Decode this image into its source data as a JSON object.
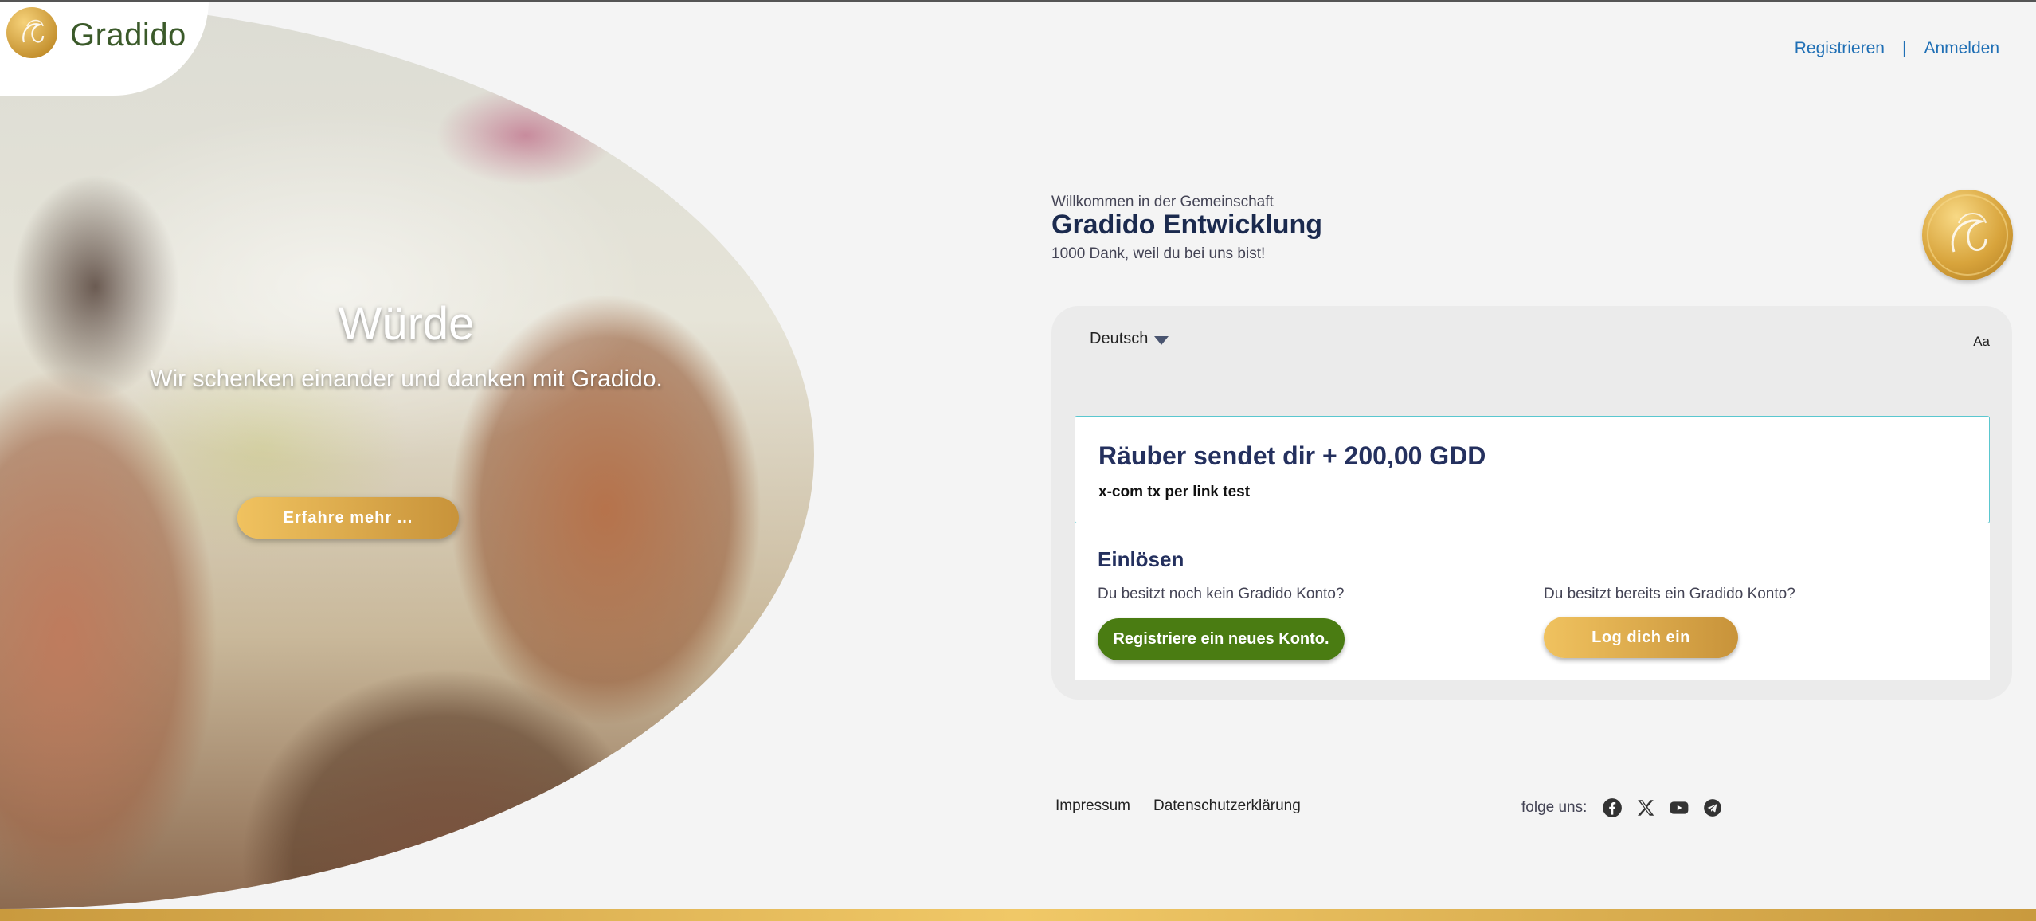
{
  "header": {
    "logo_text": "Gradido",
    "nav": {
      "register": "Registrieren",
      "separator": "|",
      "login": "Anmelden"
    }
  },
  "hero": {
    "title": "Würde",
    "subtitle": "Wir schenken einander und danken mit Gradido.",
    "button": "Erfahre mehr ..."
  },
  "welcome": {
    "intro": "Willkommen in der Gemeinschaft",
    "community": "Gradido Entwicklung",
    "thanks": "1000 Dank, weil du bei uns bist!"
  },
  "card": {
    "language": "Deutsch",
    "font_toggle": "Aa",
    "transaction": {
      "title": "Räuber sendet dir + 200,00 GDD",
      "memo": "x-com tx per link test"
    },
    "redeem": {
      "title": "Einlösen",
      "no_account_question": "Du besitzt noch kein Gradido Konto?",
      "has_account_question": "Du besitzt bereits ein Gradido Konto?",
      "register_button": "Registriere ein neues Konto.",
      "login_button": "Log dich ein"
    }
  },
  "footer": {
    "imprint": "Impressum",
    "privacy": "Datenschutzerklärung",
    "follow_label": "folge uns:",
    "social_icons": [
      "facebook-icon",
      "x-icon",
      "youtube-icon",
      "telegram-icon"
    ]
  },
  "colors": {
    "gold": "#d4a64a",
    "green": "#4a7c12",
    "link_blue": "#1f6fb5",
    "navy": "#24305e",
    "teal_border": "#5ac7cf"
  }
}
